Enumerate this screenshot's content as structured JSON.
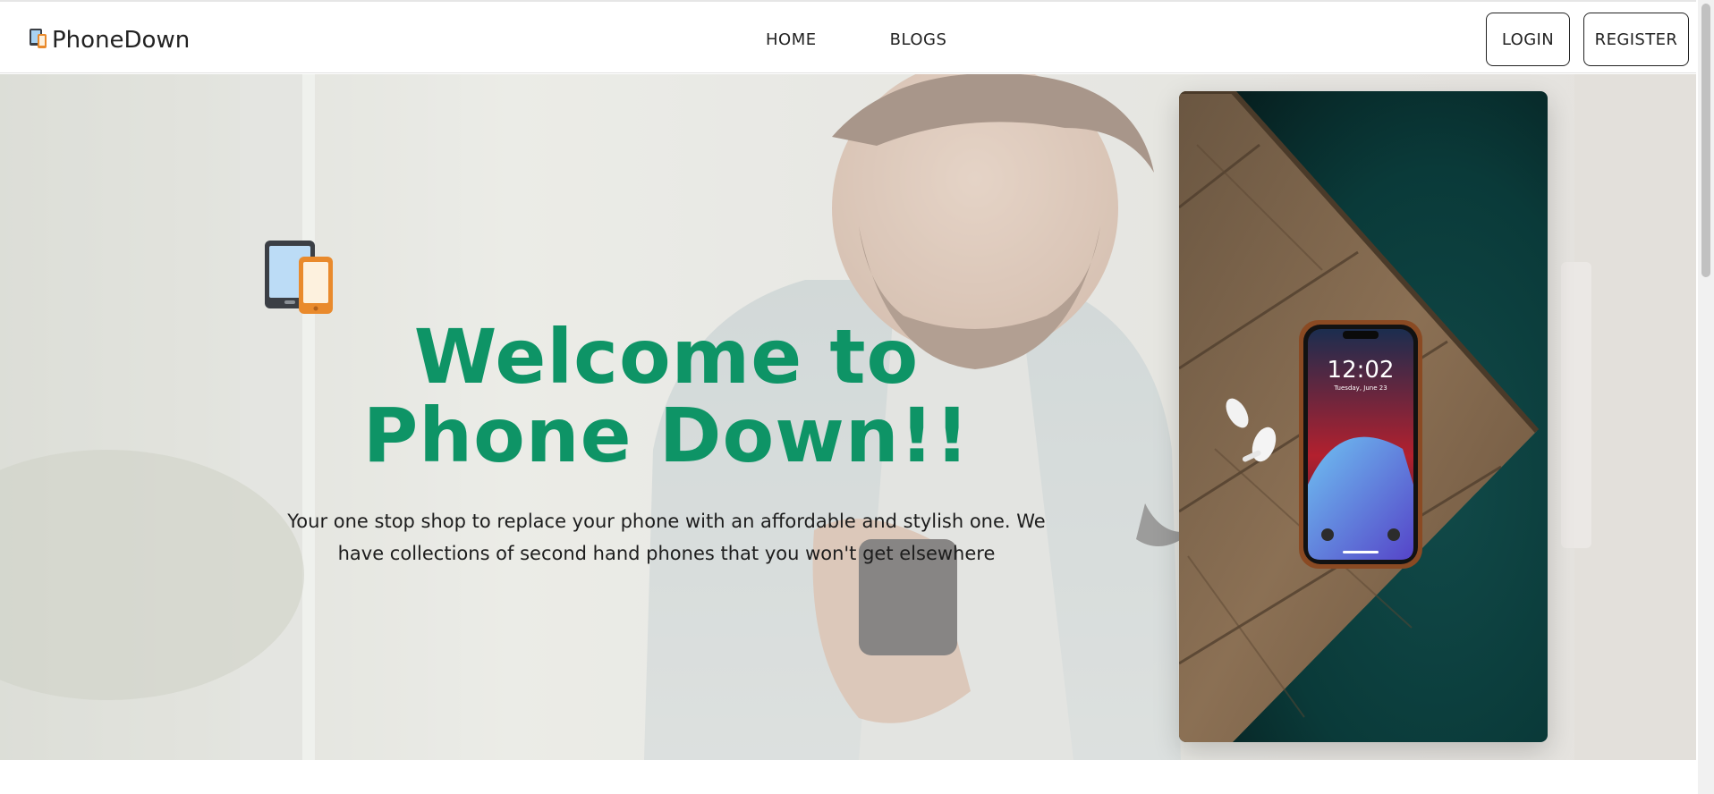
{
  "brand": {
    "name": "PhoneDown"
  },
  "nav": {
    "links": [
      {
        "label": "HOME"
      },
      {
        "label": "BLOGS"
      }
    ]
  },
  "auth": {
    "login_label": "LOGIN",
    "register_label": "REGISTER"
  },
  "hero": {
    "title": "Welcome to Phone Down!!",
    "subtitle": "Your one stop shop to replace your phone with an affordable and stylish one. We have collections of second hand phones that you won't get elsewhere",
    "accent_color": "#0e9466"
  },
  "phone_image": {
    "time": "12:02",
    "date": "Tuesday, June 23"
  },
  "icons": {
    "brand_icon": "devices-icon",
    "hero_icon": "tablet-phone-icon"
  }
}
